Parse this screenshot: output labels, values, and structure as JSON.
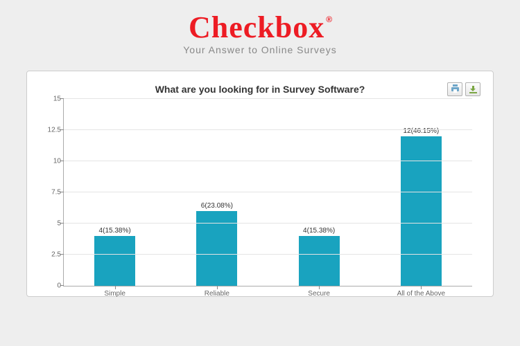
{
  "brand": {
    "name": "Checkbox",
    "registered": "®",
    "tagline": "Your Answer to Online Surveys"
  },
  "chart_data": {
    "type": "bar",
    "title": "What are you looking for in Survey Software?",
    "categories": [
      "Simple",
      "Reliable",
      "Secure",
      "All of the Above"
    ],
    "values": [
      4,
      6,
      4,
      12
    ],
    "percents": [
      15.38,
      23.08,
      15.38,
      46.15
    ],
    "bar_labels": [
      "4(15.38%)",
      "6(23.08%)",
      "4(15.38%)",
      "12(46.15%)"
    ],
    "ylim": [
      0,
      15
    ],
    "yticks": [
      0,
      2.5,
      5,
      7.5,
      10,
      12.5,
      15
    ],
    "xlabel": "",
    "ylabel": ""
  }
}
